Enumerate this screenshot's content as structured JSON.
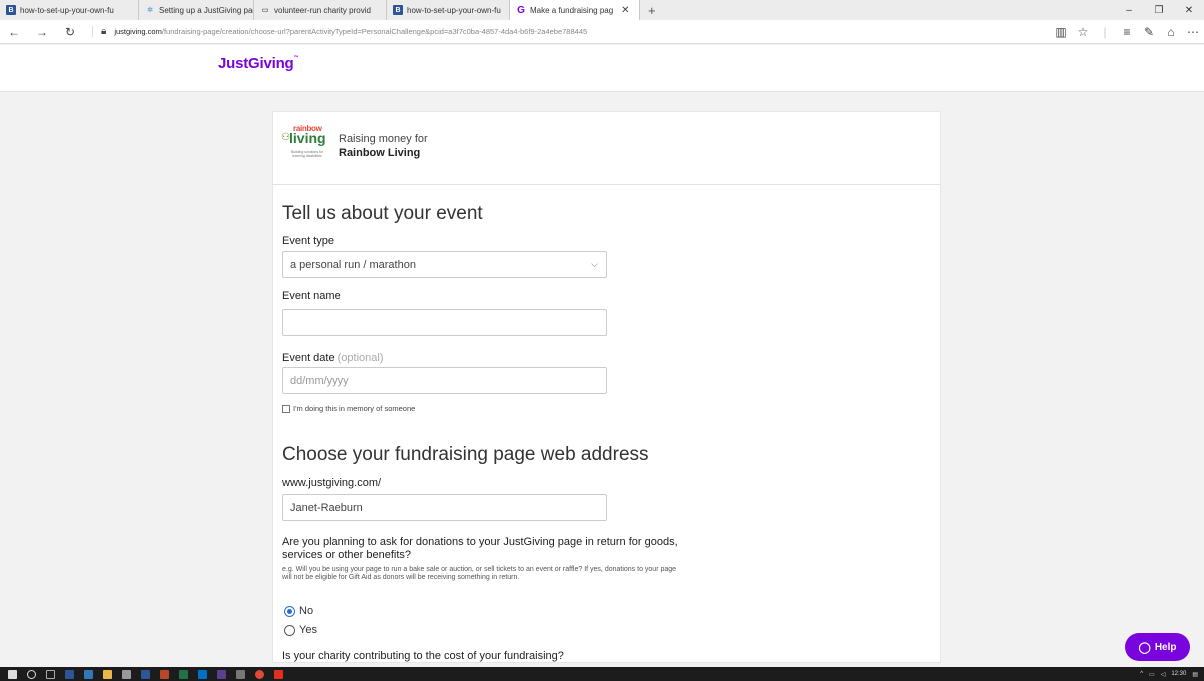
{
  "browser": {
    "tabs": [
      {
        "label": "how-to-set-up-your-own-fu",
        "fav": "B",
        "fav_color": "#2f5496"
      },
      {
        "label": "Setting up a JustGiving pag",
        "fav": "✲",
        "fav_color": "#6fa8dc"
      },
      {
        "label": "volunteer-run charity provid",
        "fav": "▭",
        "fav_color": "#888888"
      },
      {
        "label": "how-to-set-up-your-own-fu",
        "fav": "B",
        "fav_color": "#2f5496"
      },
      {
        "label": "Make a fundraising pag",
        "fav": "G",
        "fav_color": "#7a04dd",
        "active": true
      }
    ],
    "url_host": "justgiving.com",
    "url_path": "/fundraising-page/creation/choose-url?parentActivityTypeId=PersonalChallenge&pcid=a3f7c0ba-4857-4da4-b6f9-2a4ebe788445"
  },
  "header": {
    "logo": "JustGiving"
  },
  "charity": {
    "logo_top": "rainbow",
    "logo_main": "living",
    "logo_tag": "Building solutions for learning disabilities",
    "raising_label": "Raising money for",
    "name": "Rainbow Living"
  },
  "event": {
    "heading": "Tell us about your event",
    "type_label": "Event type",
    "type_value": "a personal run / marathon",
    "name_label": "Event name",
    "name_value": "",
    "date_label": "Event date",
    "date_optional": "(optional)",
    "date_placeholder": "dd/mm/yyyy",
    "memory_label": "I'm doing this in memory of someone"
  },
  "address": {
    "heading": "Choose your fundraising page web address",
    "prefix": "www.justgiving.com/",
    "value": "Janet-Raeburn"
  },
  "benefits": {
    "question": "Are you planning to ask for donations to your JustGiving page in return for goods, services or other benefits?",
    "hint": "e.g. Will you be using your page to run a bake sale or auction, or sell tickets to an event or raffle? If yes, donations to your page will not be eligible for Gift Aid as donors will be receiving something in return.",
    "options": [
      "No",
      "Yes"
    ],
    "selected": "No"
  },
  "contribution": {
    "question": "Is your charity contributing to the cost of your fundraising?"
  },
  "help": {
    "label": "Help"
  },
  "taskbar": {
    "time": "12:30"
  }
}
